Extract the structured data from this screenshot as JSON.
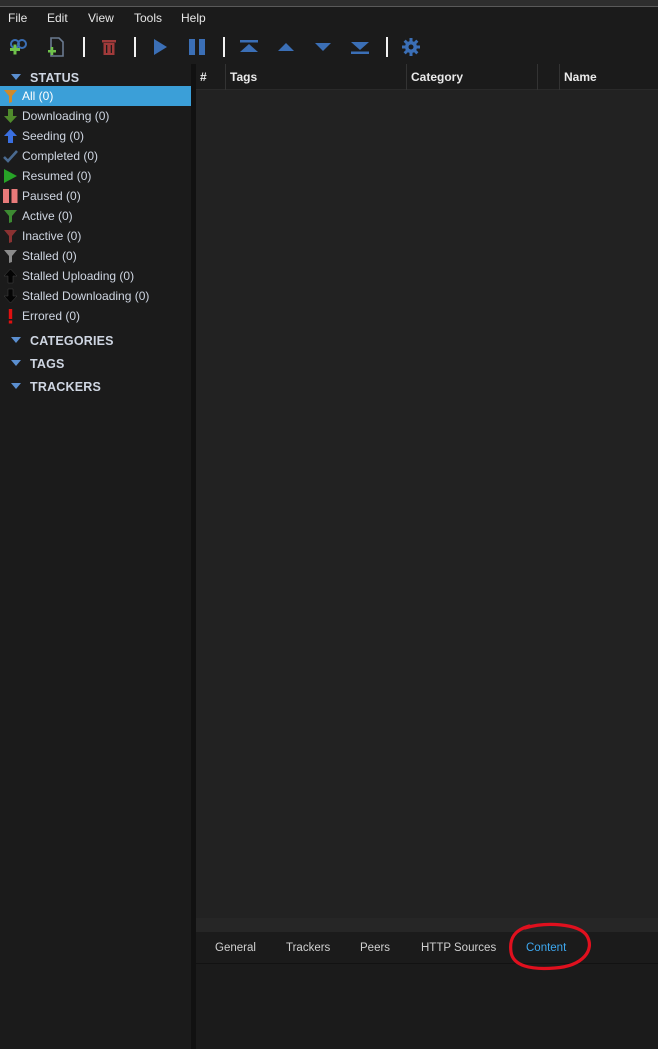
{
  "menubar": {
    "items": [
      {
        "label": "File"
      },
      {
        "label": "Edit"
      },
      {
        "label": "View"
      },
      {
        "label": "Tools"
      },
      {
        "label": "Help"
      }
    ]
  },
  "toolbar": {
    "buttons": [
      {
        "icon": "add-torrent-link-icon"
      },
      {
        "icon": "add-torrent-file-icon"
      },
      {
        "icon": "delete-icon"
      },
      {
        "icon": "resume-icon"
      },
      {
        "icon": "pause-icon"
      },
      {
        "icon": "move-to-top-icon"
      },
      {
        "icon": "move-up-icon"
      },
      {
        "icon": "move-down-icon"
      },
      {
        "icon": "move-to-bottom-icon"
      },
      {
        "icon": "settings-gear-icon"
      }
    ]
  },
  "sidebar": {
    "status_header": "STATUS",
    "status_items": [
      {
        "label": "All (0)",
        "icon": "filter-icon",
        "selected": true
      },
      {
        "label": "Downloading (0)",
        "icon": "download-arrow-icon"
      },
      {
        "label": "Seeding (0)",
        "icon": "upload-arrow-icon"
      },
      {
        "label": "Completed (0)",
        "icon": "checkmark-icon"
      },
      {
        "label": "Resumed (0)",
        "icon": "play-icon"
      },
      {
        "label": "Paused (0)",
        "icon": "pause-icon"
      },
      {
        "label": "Active (0)",
        "icon": "filter-icon"
      },
      {
        "label": "Inactive (0)",
        "icon": "filter-icon"
      },
      {
        "label": "Stalled (0)",
        "icon": "filter-icon"
      },
      {
        "label": "Stalled Uploading (0)",
        "icon": "upload-arrow-icon"
      },
      {
        "label": "Stalled Downloading (0)",
        "icon": "download-arrow-icon"
      },
      {
        "label": "Errored (0)",
        "icon": "exclamation-icon"
      }
    ],
    "categories_header": "CATEGORIES",
    "tags_header": "TAGS",
    "trackers_header": "TRACKERS"
  },
  "torrent_list": {
    "columns": [
      {
        "label": "#"
      },
      {
        "label": "Tags"
      },
      {
        "label": "Category"
      },
      {
        "label": ""
      },
      {
        "label": "Name"
      }
    ]
  },
  "properties": {
    "tabs": [
      {
        "label": "General"
      },
      {
        "label": "Trackers"
      },
      {
        "label": "Peers"
      },
      {
        "label": "HTTP Sources"
      },
      {
        "label": "Content",
        "active": true
      }
    ]
  },
  "colors": {
    "accent": "#3b9fd8",
    "active_tab": "#3ea8ef",
    "annotation": "#e0101e"
  }
}
